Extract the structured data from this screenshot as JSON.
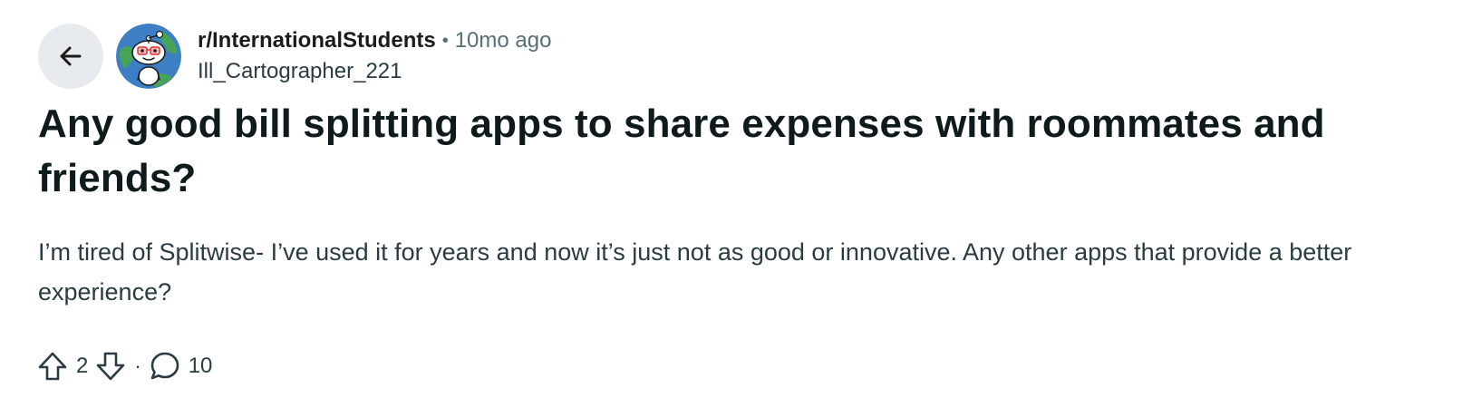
{
  "post": {
    "subreddit": "r/InternationalStudents",
    "separator": "•",
    "time_ago": "10mo ago",
    "author": "Ill_Cartographer_221",
    "title": "Any good bill splitting apps to share expenses with roommates and friends?",
    "body": "I’m tired of Splitwise- I’ve used it for years and now it’s just not as good or innovative. Any other apps that provide a better experience?",
    "votes": "2",
    "actions_separator": "·",
    "comments": "10"
  },
  "icons": {
    "back": "arrow-left-icon",
    "avatar": "subreddit-snoo-globe-icon",
    "upvote": "upvote-arrow-icon",
    "downvote": "downvote-arrow-icon",
    "comment": "comment-bubble-icon"
  },
  "colors": {
    "back_button_bg": "#e8ebee",
    "text_primary": "#0f1a1c",
    "text_secondary": "#576f76",
    "avatar_globe": "#3d7ec4",
    "avatar_land": "#46a35a"
  }
}
